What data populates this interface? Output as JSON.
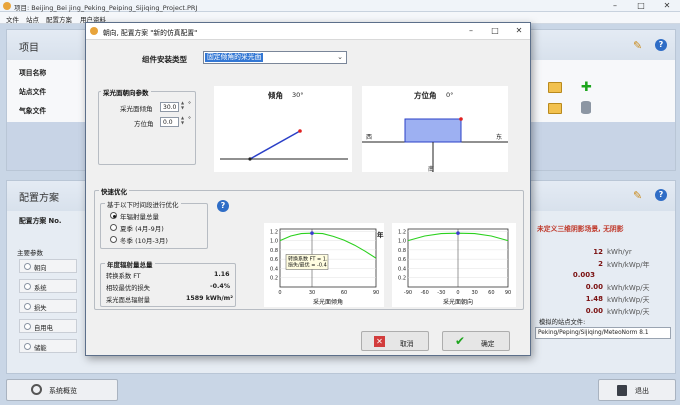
{
  "window": {
    "title": "项目: Beijing_Bei jing_Peking_Peiping_Sijiqing_Project.PRJ",
    "min_icon": "minimize-icon",
    "max_icon": "maximize-icon",
    "close_icon": "close-icon"
  },
  "menu": [
    "文件",
    "站点",
    "配置方案",
    "用户资料"
  ],
  "project": {
    "header": "项目",
    "rows": [
      "项目名称",
      "站点文件",
      "气象文件"
    ]
  },
  "config": {
    "header": "配置方案",
    "name_label": "配置方案 No.",
    "params_label": "主要参数",
    "side_items": [
      "朝向",
      "系统",
      "损失",
      "自用电",
      "储能"
    ]
  },
  "results": {
    "note": "未定义三维阴影场景, 无阴影",
    "rows": [
      {
        "v": "12",
        "u": "kWh/yr"
      },
      {
        "v": "2",
        "u": "kWh/kWp/年"
      },
      {
        "v": "0.003",
        "u": ""
      },
      {
        "v": "0.00",
        "u": "kWh/kWp/天"
      },
      {
        "v": "1.48",
        "u": "kWh/kWp/天"
      },
      {
        "v": "0.00",
        "u": "kWh/kWp/天"
      }
    ],
    "meteo_label": "模拟的站点文件:",
    "meteo_value": "Peking/Peping/Sijiqing/MeteoNorm 8.1"
  },
  "bottom": {
    "overview": "系统概览",
    "exit": "退出"
  },
  "dialog": {
    "title": "朝向, 配置方案 \"新的仿真配置\"",
    "type_label": "组件安装类型",
    "type_value": "固定倾角的采光面",
    "orient_group": "采光面朝向参数",
    "tilt_label": "采光面倾角",
    "tilt_value": "30.0",
    "azimuth_label": "方位角",
    "azimuth_value": "0.0",
    "deg": "°",
    "tilt_title": "倾角",
    "tilt_deg": "30°",
    "az_title": "方位角",
    "az_deg": "0°",
    "west": "西",
    "east": "东",
    "south": "南",
    "quick_group": "快速优化",
    "opt_group": "基于以下时间段进行优化",
    "options": [
      {
        "label": "年辐射量总量",
        "selected": true
      },
      {
        "label": "夏季 (4月-9月)",
        "selected": false
      },
      {
        "label": "冬季 (10月-3月)",
        "selected": false
      }
    ],
    "irr_group": "年度辐射量总量",
    "irr_rows": [
      {
        "k": "转换系数 FT",
        "v": "1.16"
      },
      {
        "k": "相较最优的损失",
        "v": "-0.4%"
      },
      {
        "k": "采光面总辐射量",
        "v": "1589 kWh/m²"
      }
    ],
    "cancel": "取消",
    "ok": "确定"
  },
  "chart_data": [
    {
      "type": "line",
      "year_label": "年",
      "xlabel": "采光面倾角",
      "tooltip": [
        "转换系数 FT = 1.",
        "损失/最优 = -0.4"
      ],
      "x": [
        0,
        10,
        20,
        30,
        40,
        50,
        60,
        70,
        80,
        90
      ],
      "values": [
        1.0,
        1.1,
        1.15,
        1.16,
        1.15,
        1.09,
        1.01,
        0.9,
        0.77,
        0.62
      ],
      "xticks": [
        0,
        30,
        60,
        90
      ],
      "yticks": [
        0.2,
        0.4,
        0.6,
        0.8,
        1.0,
        1.2
      ],
      "xlim": [
        0,
        90
      ],
      "ylim": [
        0,
        1.25
      ],
      "marker_x": 30,
      "marker_y": 1.16,
      "color": "#2bd11e"
    },
    {
      "type": "line",
      "xlabel": "采光面朝向",
      "x": [
        -90,
        -60,
        -30,
        0,
        30,
        60,
        90
      ],
      "values": [
        1.0,
        1.1,
        1.15,
        1.16,
        1.15,
        1.1,
        1.0
      ],
      "xticks": [
        -90,
        -60,
        -30,
        0,
        30,
        60,
        90
      ],
      "yticks": [
        0.2,
        0.4,
        0.6,
        0.8,
        1.0,
        1.2
      ],
      "xlim": [
        -90,
        90
      ],
      "ylim": [
        0,
        1.25
      ],
      "marker_x": 0,
      "marker_y": 1.16,
      "color": "#2bd11e"
    }
  ]
}
